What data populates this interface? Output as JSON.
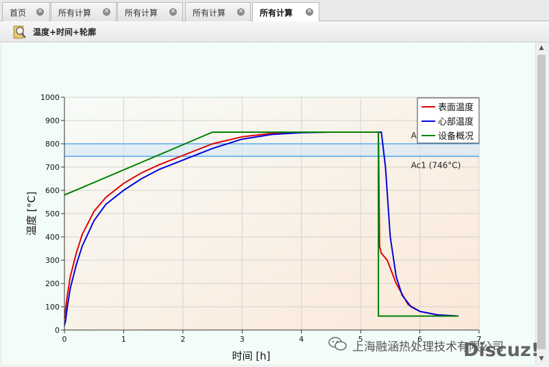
{
  "tabs": [
    {
      "label": "首页",
      "active": false
    },
    {
      "label": "所有计算",
      "active": false
    },
    {
      "label": "所有计算",
      "active": false
    },
    {
      "label": "所有计算",
      "active": false
    },
    {
      "label": "所有计算",
      "active": true
    }
  ],
  "toolbar": {
    "title": "温度+时间+轮廓",
    "icon": "search-icon"
  },
  "watermark": {
    "text": "上海融涵热处理技术有限公司",
    "brand": "Discuz!"
  },
  "colors": {
    "surface": "#e00000",
    "core": "#0000dd",
    "equipment": "#008000",
    "ac_band": "#5aaaf0"
  },
  "chart_data": {
    "type": "line",
    "xlabel": "时间 [h]",
    "ylabel": "温度 [°C]",
    "xlim": [
      0,
      7
    ],
    "ylim": [
      0,
      1000
    ],
    "xticks": [
      "0",
      "1",
      "2",
      "3",
      "4",
      "5",
      "6",
      "7"
    ],
    "yticks": [
      "0",
      "100",
      "200",
      "300",
      "400",
      "500",
      "600",
      "700",
      "800",
      "900",
      "1000"
    ],
    "grid": true,
    "legend_position": "top-right",
    "annotations": [
      {
        "label": "A",
        "value": 800
      },
      {
        "label": "Ac1 (746°C)",
        "value": 746
      }
    ],
    "series": [
      {
        "name": "表面温度",
        "color": "#e00000",
        "x": [
          0,
          0.05,
          0.1,
          0.2,
          0.3,
          0.5,
          0.7,
          1.0,
          1.3,
          1.6,
          2.0,
          2.5,
          3.0,
          3.5,
          4.0,
          4.5,
          5.0,
          5.3,
          5.32,
          5.35,
          5.45,
          5.6,
          5.8,
          6.0,
          6.3,
          6.65
        ],
        "y": [
          50,
          150,
          230,
          330,
          410,
          510,
          570,
          630,
          675,
          710,
          750,
          800,
          830,
          845,
          850,
          850,
          850,
          850,
          360,
          330,
          300,
          200,
          110,
          80,
          65,
          60
        ]
      },
      {
        "name": "心部温度",
        "color": "#0000dd",
        "x": [
          0,
          0.02,
          0.05,
          0.1,
          0.2,
          0.3,
          0.5,
          0.7,
          1.0,
          1.3,
          1.6,
          2.0,
          2.5,
          3.0,
          3.5,
          4.0,
          4.5,
          5.0,
          5.3,
          5.35,
          5.42,
          5.5,
          5.6,
          5.7,
          5.85,
          6.0,
          6.3,
          6.65
        ],
        "y": [
          20,
          40,
          100,
          180,
          280,
          360,
          470,
          540,
          600,
          650,
          690,
          730,
          780,
          820,
          840,
          848,
          850,
          850,
          850,
          850,
          700,
          400,
          230,
          150,
          100,
          80,
          65,
          60
        ]
      },
      {
        "name": "设备概况",
        "color": "#008000",
        "x": [
          0,
          2.5,
          5.3,
          5.3,
          6.65
        ],
        "y": [
          580,
          850,
          850,
          60,
          60
        ]
      }
    ]
  }
}
